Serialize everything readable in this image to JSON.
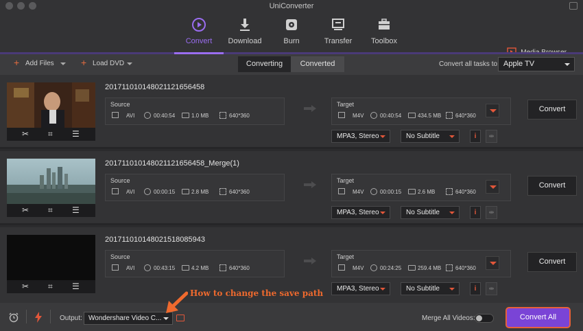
{
  "window": {
    "title": "UniConverter"
  },
  "toolbar": {
    "tabs": [
      {
        "label": "Convert",
        "icon": "convert-icon",
        "active": true
      },
      {
        "label": "Download",
        "icon": "download-icon",
        "active": false
      },
      {
        "label": "Burn",
        "icon": "burn-icon",
        "active": false
      },
      {
        "label": "Transfer",
        "icon": "transfer-icon",
        "active": false
      },
      {
        "label": "Toolbox",
        "icon": "toolbox-icon",
        "active": false
      }
    ],
    "media_browser": "Media Browser"
  },
  "subbar": {
    "add_files": "Add Files",
    "load_dvd": "Load DVD",
    "segments": {
      "converting": "Converting",
      "converted": "Converted"
    },
    "convert_all_label": "Convert all tasks to:",
    "convert_all_target": "Apple TV"
  },
  "tasks": [
    {
      "name": "20171101014802112165645​8",
      "source": {
        "label": "Source",
        "format": "AVI",
        "duration": "00:40:54",
        "size": "1.0 MB",
        "resolution": "640*360"
      },
      "target": {
        "label": "Target",
        "format": "M4V",
        "duration": "00:40:54",
        "size": "434.5 MB",
        "resolution": "640*360"
      },
      "audio": "MPA3, Stereo",
      "subtitle": "No Subtitle",
      "convert_label": "Convert"
    },
    {
      "name": "20171101014802112165645​8_Merge(1)",
      "source": {
        "label": "Source",
        "format": "AVI",
        "duration": "00:00:15",
        "size": "2.8 MB",
        "resolution": "640*360"
      },
      "target": {
        "label": "Target",
        "format": "M4V",
        "duration": "00:00:15",
        "size": "2.6 MB",
        "resolution": "640*360"
      },
      "audio": "MPA3, Stereo",
      "subtitle": "No Subtitle",
      "convert_label": "Convert"
    },
    {
      "name": "20171101014802151808594​3",
      "source": {
        "label": "Source",
        "format": "AVI",
        "duration": "00:43:15",
        "size": "4.2 MB",
        "resolution": "640*360"
      },
      "target": {
        "label": "Target",
        "format": "M4V",
        "duration": "00:24:25",
        "size": "259.4 MB",
        "resolution": "640*360"
      },
      "audio": "MPA3, Stereo",
      "subtitle": "No Subtitle",
      "convert_label": "Convert"
    }
  ],
  "bottom": {
    "output_label": "Output:",
    "output_path": "Wondershare Video C...",
    "merge_label": "Merge All Videos:",
    "merge_enabled": false,
    "convert_all": "Convert All"
  },
  "annotation": "How to change the save path",
  "colors": {
    "accent": "#9a6df0",
    "highlight": "#e8603a",
    "button_purple": "#7a44d6"
  }
}
